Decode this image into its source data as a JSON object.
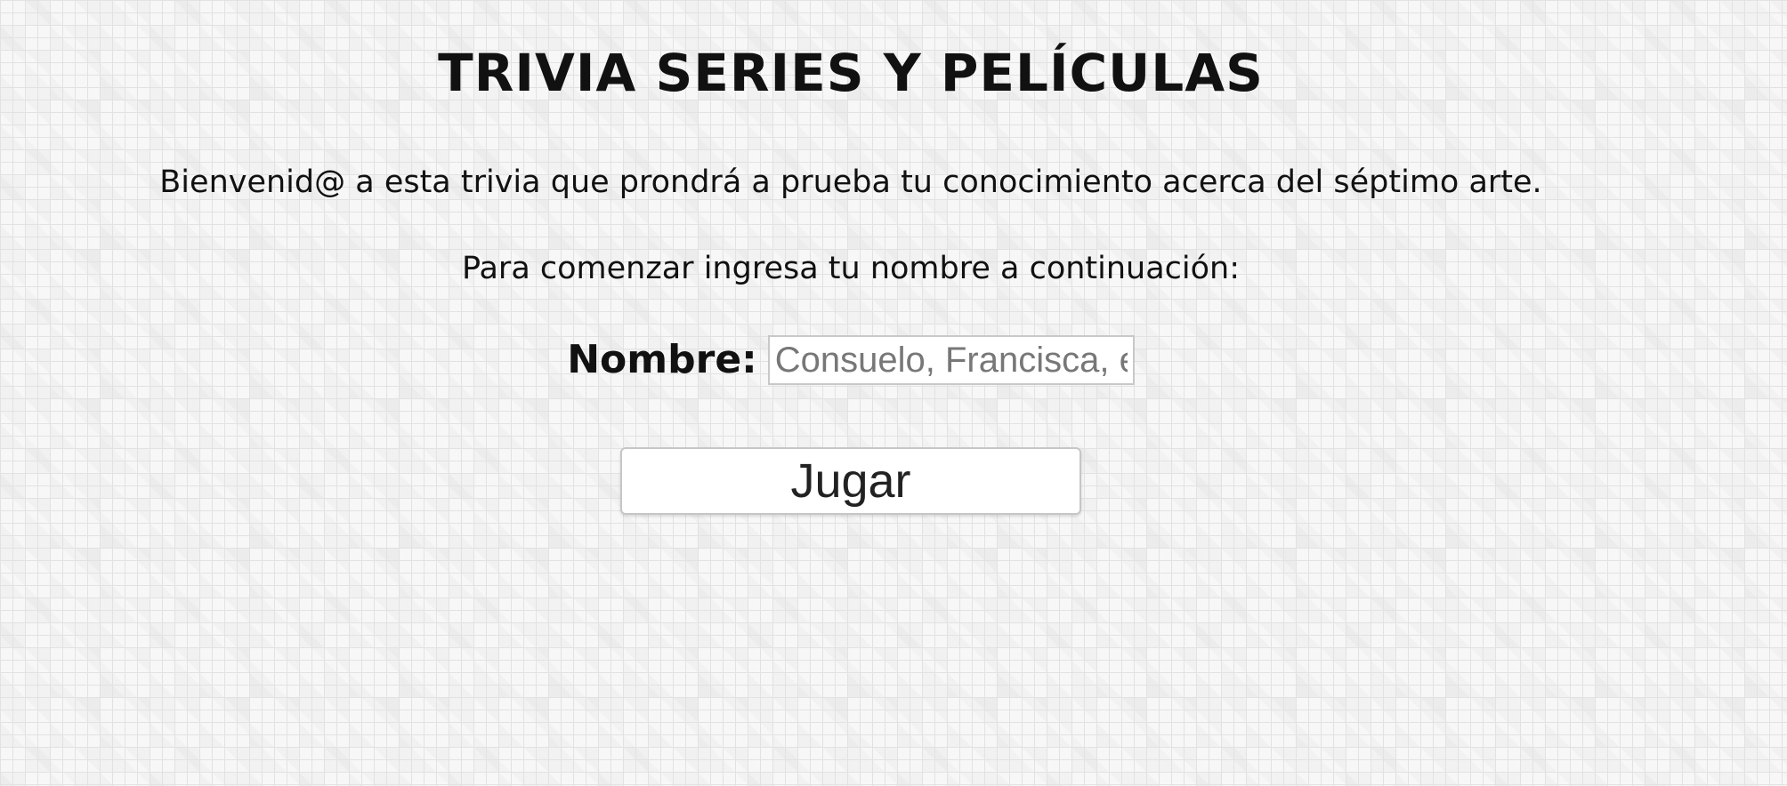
{
  "header": {
    "title": "TRIVIA SERIES Y PELÍCULAS"
  },
  "intro": {
    "text": "Bienvenid@ a esta trivia que prondrá a prueba tu conocimiento acerca del séptimo arte."
  },
  "instruction": {
    "text": "Para comenzar ingresa tu nombre a continuación:"
  },
  "form": {
    "name_label": "Nombre:",
    "name_value": "",
    "name_placeholder": "Consuelo, Francisca, etc.",
    "play_label": "Jugar"
  }
}
